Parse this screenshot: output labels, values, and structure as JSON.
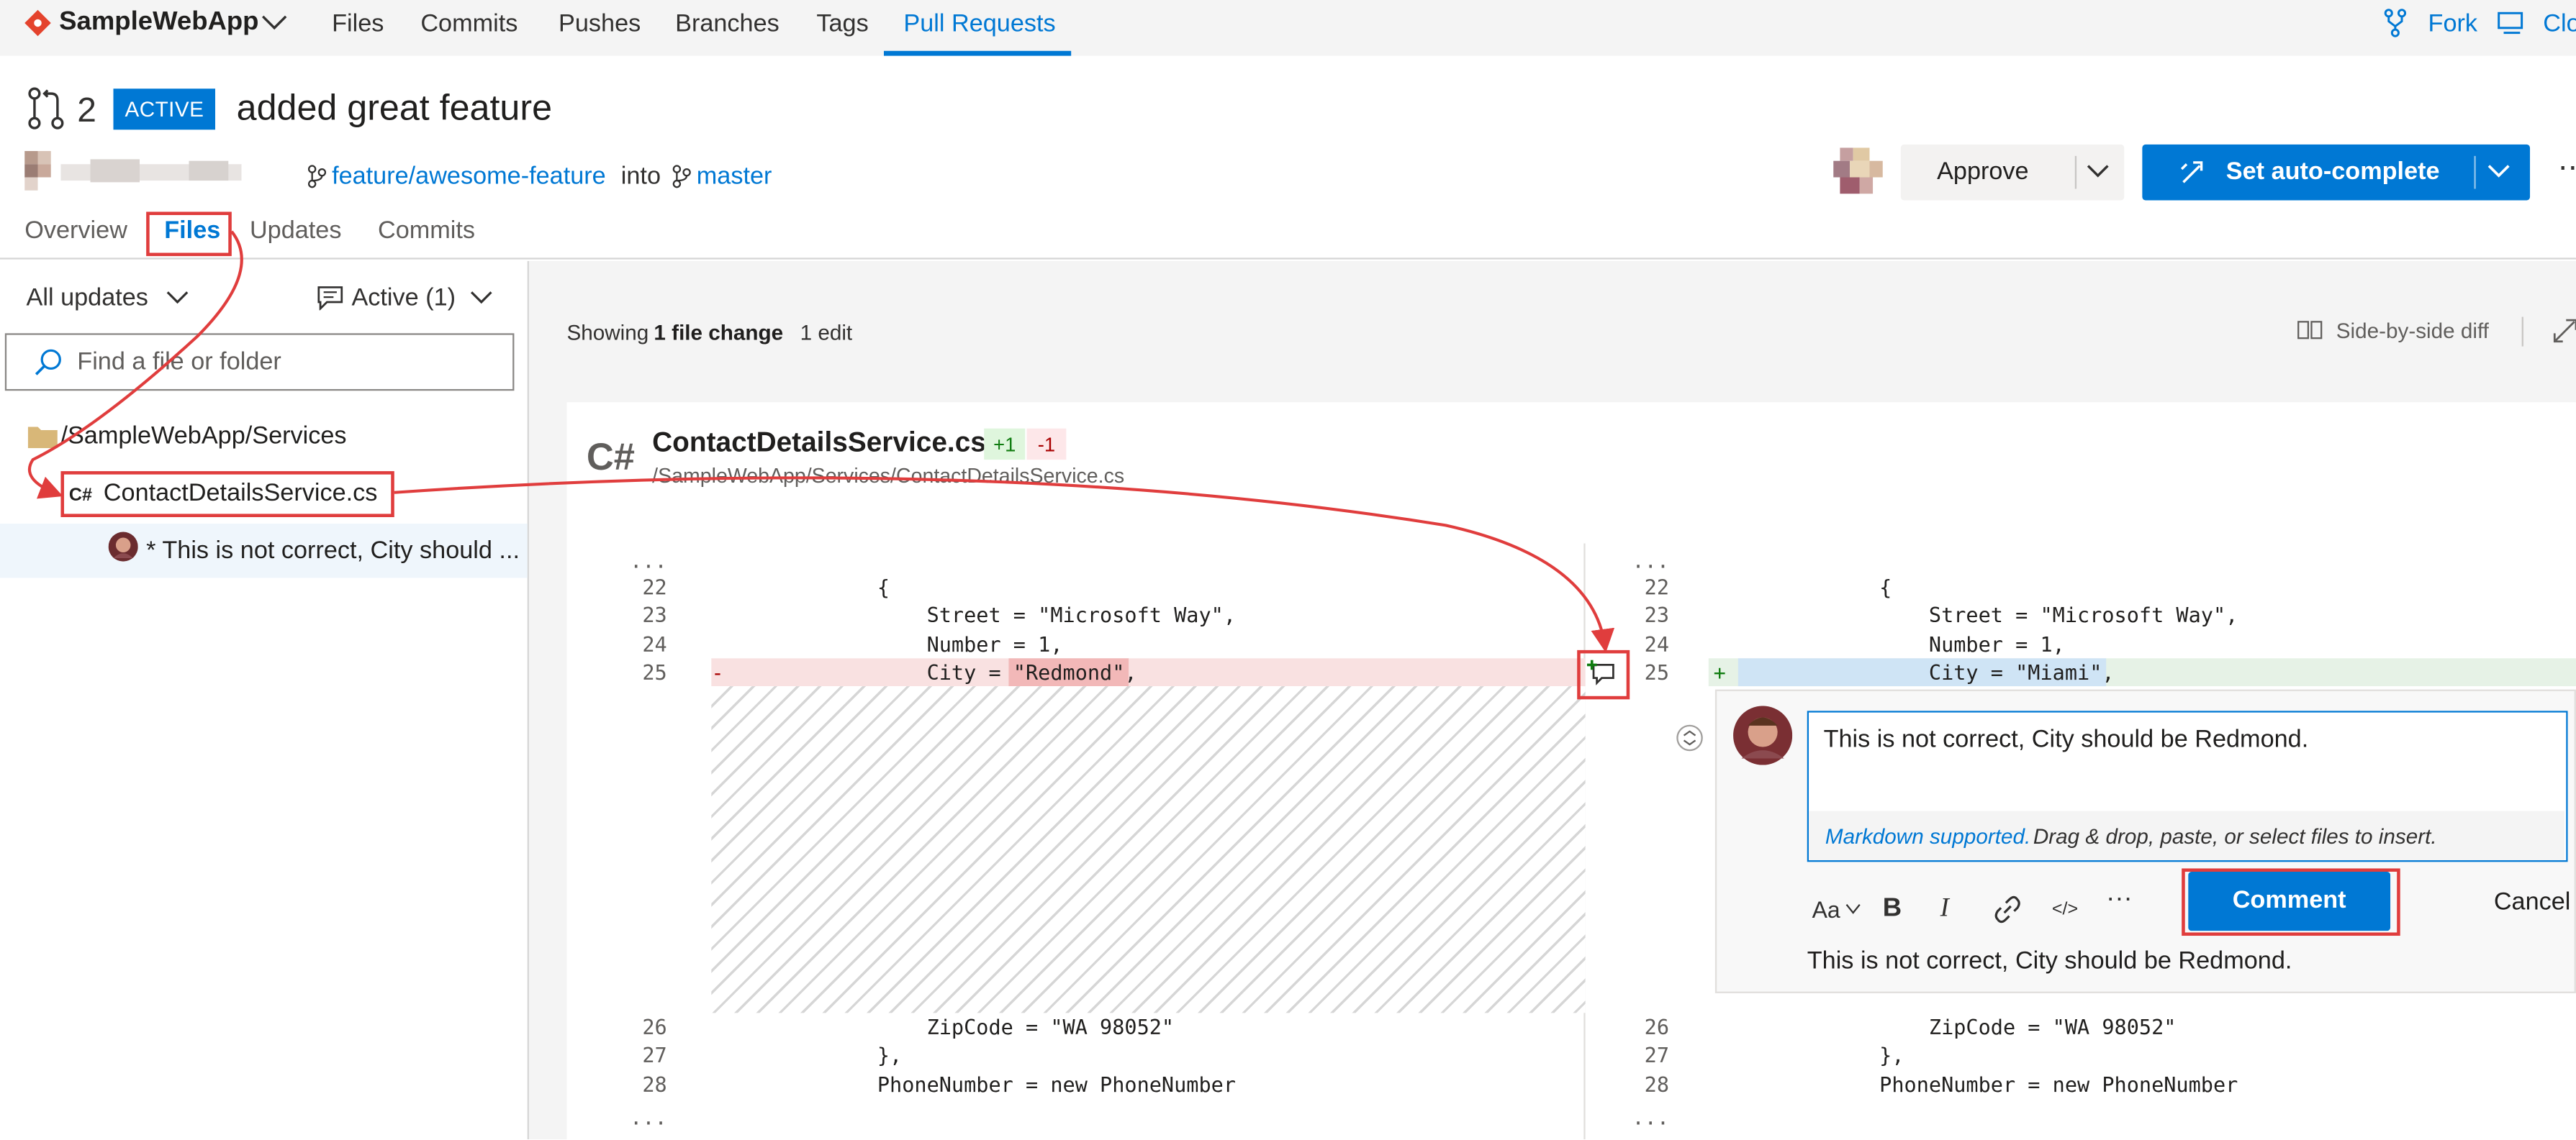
{
  "topnav": {
    "project": "SampleWebApp",
    "links": [
      "Files",
      "Commits",
      "Pushes",
      "Branches",
      "Tags",
      "Pull Requests"
    ],
    "fork": "Fork",
    "clone": "Clo"
  },
  "pr": {
    "id": "2",
    "status": "ACTIVE",
    "title": "added great feature",
    "source_branch": "feature/awesome-feature",
    "into": "into",
    "target_branch": "master",
    "approve_label": "Approve",
    "autocomplete_label": "Set auto-complete",
    "more": "⋯"
  },
  "tabs": [
    "Overview",
    "Files",
    "Updates",
    "Commits"
  ],
  "sidebar": {
    "updates_filter": "All updates",
    "comments_filter": "Active (1)",
    "search_placeholder": "Find a file or folder",
    "folder": "/SampleWebApp/Services",
    "file": "ContactDetailsService.cs",
    "file_lang": "C#",
    "comment_preview": "* This is not correct, City should ..."
  },
  "summary": {
    "prefix": "Showing",
    "count": "1 file change",
    "suffix": ":",
    "edits": "1 edit",
    "view_mode": "Side-by-side diff"
  },
  "file": {
    "lang_icon": "C#",
    "name": "ContactDetailsService.cs",
    "added": "+1",
    "removed": "-1",
    "path": "/SampleWebApp/Services/ContactDetailsService.cs"
  },
  "diff": {
    "ellipsis": "...",
    "left": [
      {
        "num": "22",
        "code": "{"
      },
      {
        "num": "23",
        "code": "    Street = \"Microsoft Way\","
      },
      {
        "num": "24",
        "code": "    Number = 1,"
      },
      {
        "num": "25",
        "code": "    City = \"Redmond\",",
        "marker": "-"
      },
      {
        "num": "26",
        "code": "    ZipCode = \"WA 98052\""
      },
      {
        "num": "27",
        "code": "},"
      },
      {
        "num": "28",
        "code": "PhoneNumber = new PhoneNumber"
      }
    ],
    "right": [
      {
        "num": "22",
        "code": "{"
      },
      {
        "num": "23",
        "code": "    Street = \"Microsoft Way\","
      },
      {
        "num": "24",
        "code": "    Number = 1,"
      },
      {
        "num": "25",
        "code": "    City = \"Miami\",",
        "marker": "+"
      },
      {
        "num": "26",
        "code": "    ZipCode = \"WA 98052\""
      },
      {
        "num": "27",
        "code": "},"
      },
      {
        "num": "28",
        "code": "PhoneNumber = new PhoneNumber"
      }
    ]
  },
  "comment": {
    "text": "This is not correct, City should be Redmond.",
    "markdown_link": "Markdown supported.",
    "hint": " Drag & drop, paste, or select files to insert.",
    "format_label": "Aa",
    "bold": "B",
    "italic": "I",
    "code": "</>",
    "more": "···",
    "submit_label": "Comment",
    "cancel_label": "Cancel",
    "preview": "This is not correct, City should be Redmond."
  },
  "colors": {
    "accent": "#0078d4",
    "removed_bg": "#f9e1e1",
    "added_bg": "#e6f2e6",
    "highlight_blue": "#cfe4f5",
    "annotation_red": "#e03d3d"
  }
}
